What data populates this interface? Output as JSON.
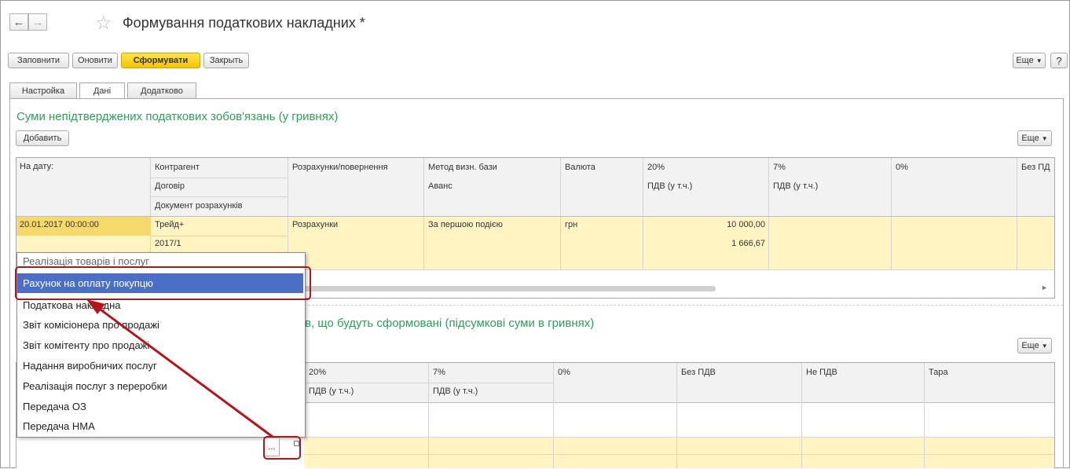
{
  "window": {
    "title": "Формування податкових накладних *"
  },
  "nav": {
    "back": "←",
    "forward": "→",
    "star": "☆"
  },
  "toolbar": {
    "fill": "Заповнити",
    "refresh": "Оновити",
    "generate": "Сформувати",
    "close": "Закрыть",
    "more": "Еще",
    "help": "?"
  },
  "tabs": [
    {
      "label": "Настройка"
    },
    {
      "label": "Дані"
    },
    {
      "label": "Додатково"
    }
  ],
  "section1": {
    "title": "Суми непідтверджених податкових зобов'язань (у гривнях)",
    "add": "Добавить",
    "more": "Еще",
    "headers": {
      "date": "На дату:",
      "counterparty": "Контрагент",
      "contract": "Договір",
      "settlement_doc": "Документ розрахунків",
      "settlements": "Розрахунки/повернення",
      "base_method": "Метод визн. бази",
      "advance": "Аванс",
      "currency": "Валюта",
      "v20": "20%",
      "vat20": "ПДВ (у т.ч.)",
      "v7": "7%",
      "vat7": "ПДВ (у т.ч.)",
      "v0": "0%",
      "novat": "Без ПД"
    },
    "row": {
      "date": "20.01.2017 00:00:00",
      "counterparty": "Трейд+",
      "contract": "2017/1",
      "settlements": "Розрахунки",
      "base_method": "За першою подією",
      "currency": "грн",
      "amount": "10 000,00",
      "vat": "1 666,67"
    }
  },
  "section2": {
    "title_fragment": "в, що будуть сформовані (підсумкові суми в гривнях)",
    "more": "Еще",
    "headers": {
      "v20": "20%",
      "vat20": "ПДВ (у т.ч.)",
      "v7": "7%",
      "vat7": "ПДВ (у т.ч.)",
      "v0": "0%",
      "novat": "Без ПДВ",
      "notvat": "Не ПДВ",
      "tara": "Тара"
    },
    "select_button": "..."
  },
  "dropdown": {
    "items": [
      {
        "label": "Реалізація товарів і послуг"
      },
      {
        "label": "Рахунок на оплату покупцю"
      },
      {
        "label": "Податкова накладна"
      },
      {
        "label": "Звіт комісіонера про продажі"
      },
      {
        "label": "Звіт комітенту про продажі"
      },
      {
        "label": "Надання виробничих послуг"
      },
      {
        "label": "Реалізація послуг з переробки"
      },
      {
        "label": "Передача ОЗ"
      },
      {
        "label": "Передача НМА"
      }
    ],
    "selected_index": 1
  },
  "colors": {
    "accent_green": "#2e9e5b",
    "selection": "#4a6fc4",
    "highlight_red": "#b0161c",
    "row_yellow": "#fff4c2"
  }
}
